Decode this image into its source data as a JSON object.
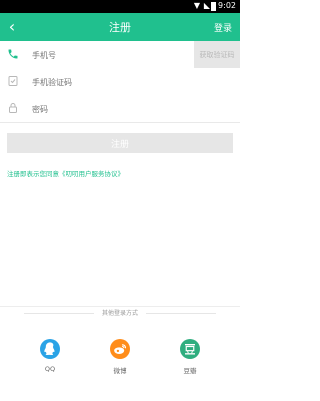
{
  "status": {
    "time": "9:02"
  },
  "header": {
    "title": "注册",
    "login_label": "登录",
    "back_icon": "chevron-left-icon",
    "bg": "#20c08e"
  },
  "form": {
    "phone": {
      "placeholder": "手机号",
      "icon": "phone-icon"
    },
    "code": {
      "placeholder": "手机验证码",
      "icon": "shield-check-icon",
      "button_label": "获取验证码"
    },
    "password": {
      "placeholder": "密码",
      "icon": "lock-icon"
    }
  },
  "submit": {
    "label": "注册"
  },
  "agreement": {
    "text": "注册即表示您同意《叨叨用户服务协议》"
  },
  "other_login": {
    "title": "其他登录方式",
    "items": [
      {
        "label": "QQ",
        "icon": "qq-icon",
        "color": "#2aa3e6"
      },
      {
        "label": "微博",
        "icon": "weibo-icon",
        "color": "#ff8d1a"
      },
      {
        "label": "豆瓣",
        "icon": "douban-icon",
        "color": "#2fae7f"
      }
    ]
  }
}
